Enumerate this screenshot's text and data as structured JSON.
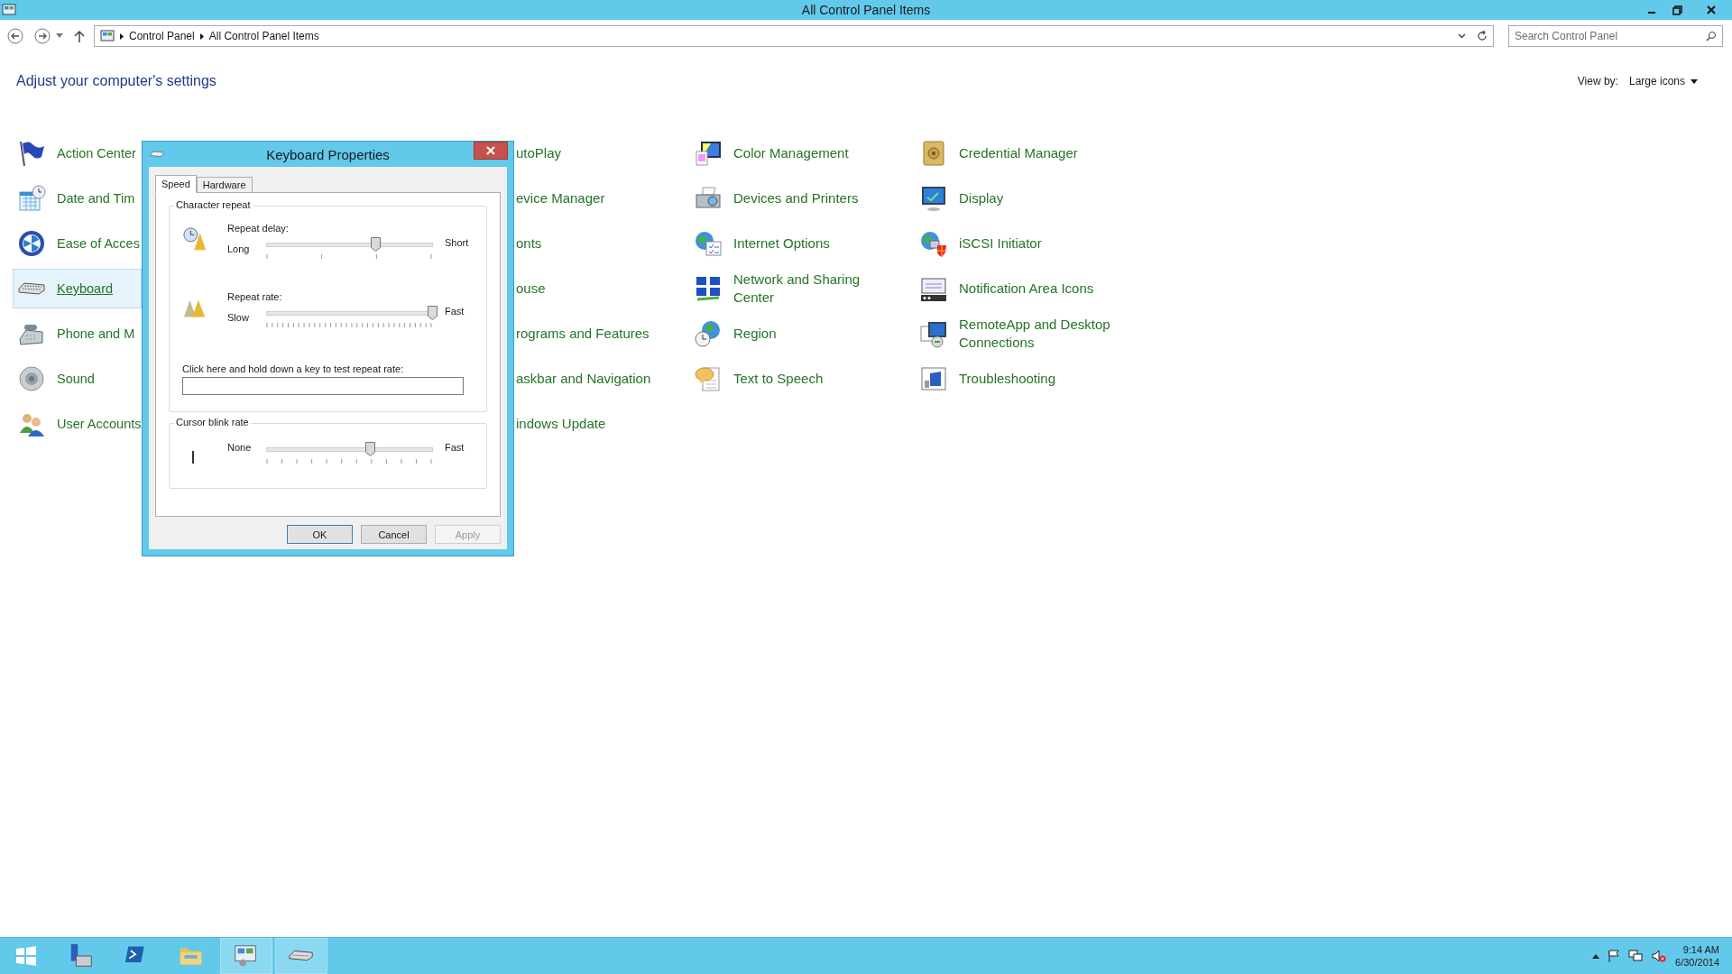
{
  "window": {
    "title": "All Control Panel Items"
  },
  "address_bar": {
    "breadcrumbs": [
      "Control Panel",
      "All Control Panel Items"
    ]
  },
  "search": {
    "placeholder": "Search Control Panel"
  },
  "heading": "Adjust your computer's settings",
  "view_by": {
    "label": "View by:",
    "value": "Large icons"
  },
  "columns": [
    [
      {
        "label": "Action Center",
        "selected": false
      },
      {
        "label": "Date and Tim",
        "selected": false
      },
      {
        "label": "Ease of Acces",
        "selected": false
      },
      {
        "label": "Keyboard",
        "selected": true
      },
      {
        "label": "Phone and M",
        "selected": false
      },
      {
        "label": "Sound",
        "selected": false
      },
      {
        "label": "User Accounts",
        "selected": false
      }
    ],
    [
      {
        "label": "utoPlay",
        "selected": false
      },
      {
        "label": "evice Manager",
        "selected": false
      },
      {
        "label": "onts",
        "selected": false
      },
      {
        "label": "ouse",
        "selected": false
      },
      {
        "label": "rograms and Features",
        "selected": false
      },
      {
        "label": "askbar and Navigation",
        "selected": false
      },
      {
        "label": "indows Update",
        "selected": false
      }
    ],
    [
      {
        "label": "Color Management",
        "selected": false
      },
      {
        "label": "Devices and Printers",
        "selected": false
      },
      {
        "label": "Internet Options",
        "selected": false
      },
      {
        "label": "Network and Sharing Center",
        "selected": false
      },
      {
        "label": "Region",
        "selected": false
      },
      {
        "label": "Text to Speech",
        "selected": false
      }
    ],
    [
      {
        "label": "Credential Manager",
        "selected": false
      },
      {
        "label": "Display",
        "selected": false
      },
      {
        "label": "iSCSI Initiator",
        "selected": false
      },
      {
        "label": "Notification Area Icons",
        "selected": false
      },
      {
        "label": "RemoteApp and Desktop Connections",
        "selected": false
      },
      {
        "label": "Troubleshooting",
        "selected": false
      }
    ]
  ],
  "dialog": {
    "title": "Keyboard Properties",
    "tabs": [
      {
        "label": "Speed",
        "selected": true
      },
      {
        "label": "Hardware",
        "selected": false
      }
    ],
    "character_repeat": {
      "title": "Character repeat",
      "sliders": [
        {
          "label": "Repeat delay:",
          "min_label": "Long",
          "max_label": "Short",
          "level": 0.66
        },
        {
          "label": "Repeat rate:",
          "min_label": "Slow",
          "max_label": "Fast",
          "level": 1
        }
      ],
      "test_label": "Click here and hold down a key to test repeat rate:"
    },
    "cursor_blink": {
      "title": "Cursor blink rate",
      "min_label": "None",
      "max_label": "Fast",
      "level": 0.63
    },
    "buttons": [
      {
        "label": "OK",
        "disabled": false
      },
      {
        "label": "Cancel",
        "disabled": false
      },
      {
        "label": "Apply",
        "disabled": true
      }
    ]
  },
  "taskbar": {
    "apps": [
      {
        "selected": false
      },
      {
        "selected": false
      },
      {
        "selected": false
      },
      {
        "selected": false
      },
      {
        "selected": true
      },
      {
        "selected": true
      }
    ],
    "clock": {
      "time": "9:14 AM",
      "date": "6/30/2014"
    }
  }
}
